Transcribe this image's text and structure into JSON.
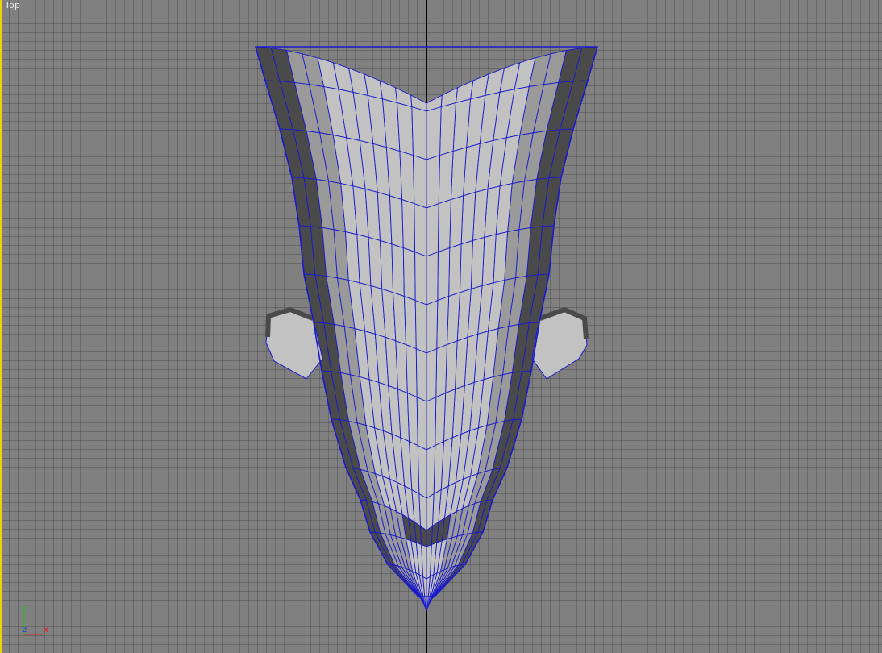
{
  "viewport": {
    "label": "Top",
    "view": "top",
    "active": true
  },
  "axis_gizmo": {
    "x_label": "x",
    "y_label": "y",
    "z_label": "z"
  },
  "colors": {
    "background": "#808080",
    "active_border": "#e8d800",
    "wireframe": "#1a1acc",
    "surface_light": "#c2c2c2",
    "surface_mid": "#9a9a9a",
    "surface_dark": "#4a4a4a",
    "axis_line": "#000000",
    "gizmo_x": "#e02020",
    "gizmo_y": "#20c020",
    "gizmo_z": "#2040e0"
  }
}
